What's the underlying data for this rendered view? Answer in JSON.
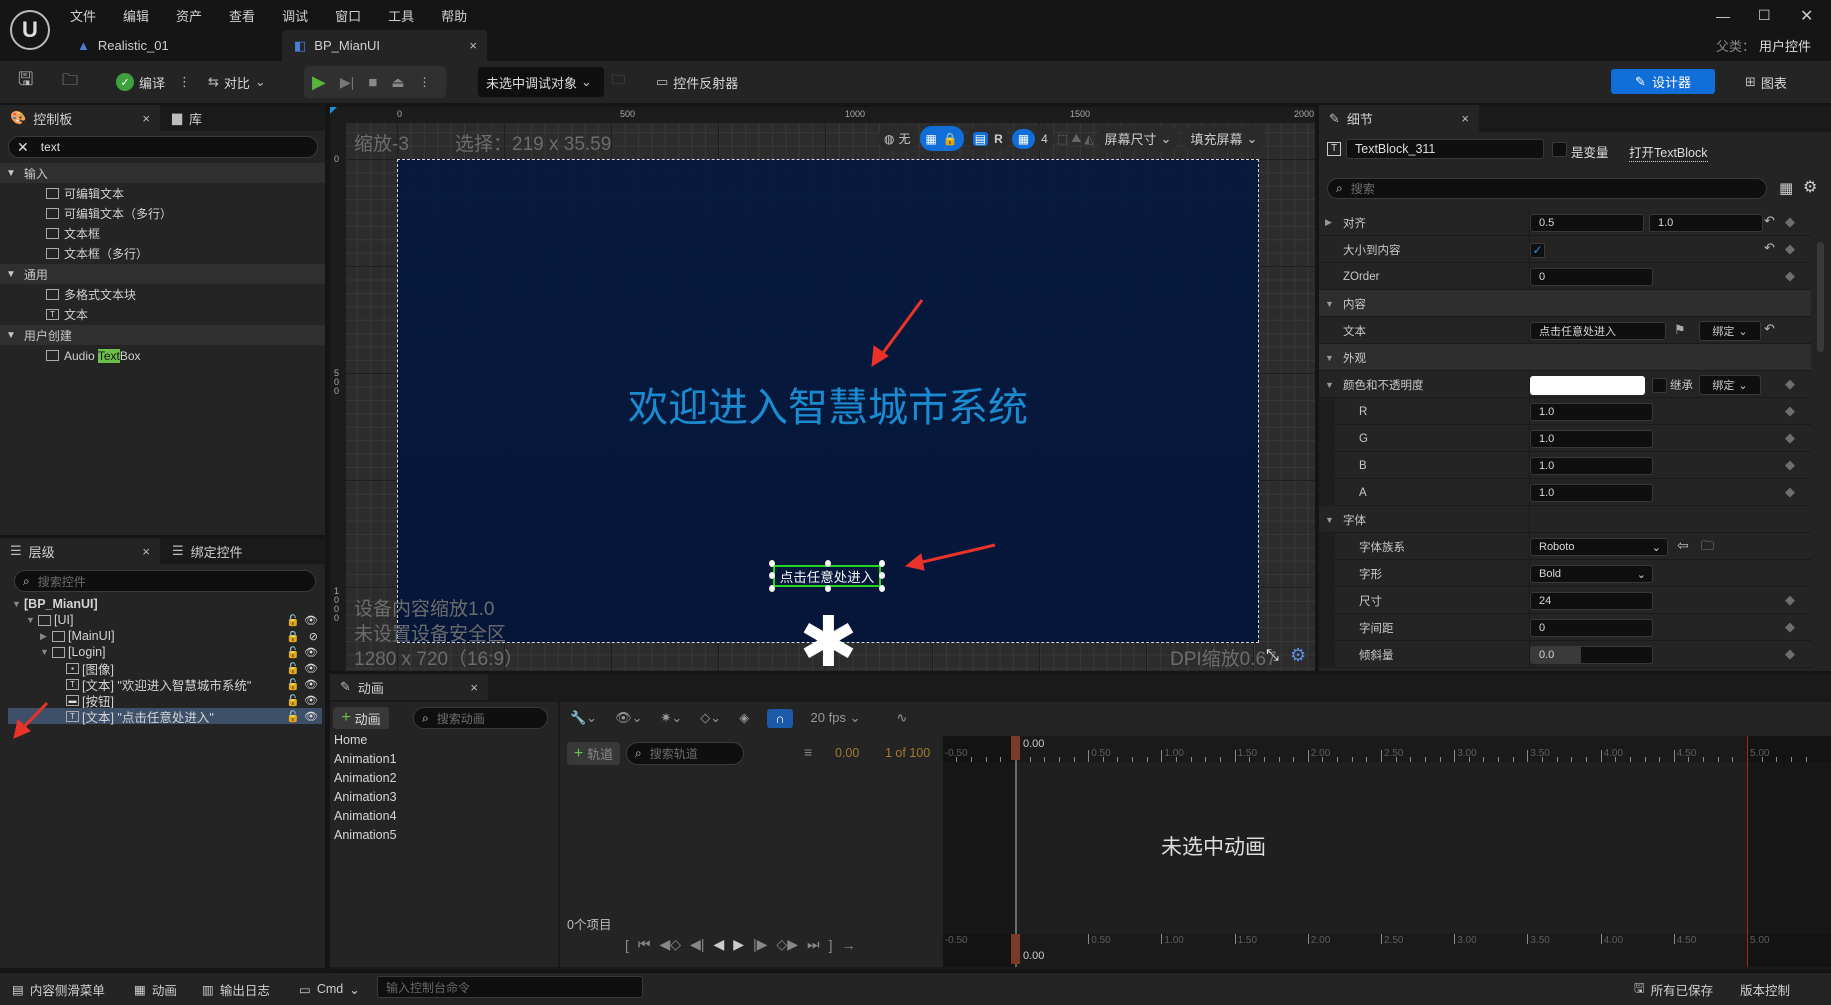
{
  "menu": [
    "文件",
    "编辑",
    "资产",
    "查看",
    "调试",
    "窗口",
    "工具",
    "帮助"
  ],
  "tabs": [
    {
      "label": "Realistic_01",
      "active": false
    },
    {
      "label": "BP_MianUI",
      "active": true
    }
  ],
  "parent_class": {
    "label": "父类：",
    "value": "用户控件"
  },
  "toolbar": {
    "compile": "编译",
    "diff": "对比",
    "debug_target": "未选中调试对象",
    "widget_reflector": "控件反射器",
    "designer": "设计器",
    "graph": "图表"
  },
  "palette": {
    "tab": "控制板",
    "tab2": "库",
    "search_value": "text",
    "categories": [
      {
        "label": "输入",
        "items": [
          {
            "label": "可编辑文本",
            "icon": "editable-text-icon"
          },
          {
            "label": "可编辑文本（多行）",
            "icon": "editable-text-multiline-icon"
          },
          {
            "label": "文本框",
            "icon": "text-box-icon"
          },
          {
            "label": "文本框（多行）",
            "icon": "text-box-multiline-icon"
          }
        ]
      },
      {
        "label": "通用",
        "items": [
          {
            "label": "多格式文本块",
            "icon": "rich-text-icon"
          },
          {
            "label": "文本",
            "icon": "text-icon"
          }
        ]
      },
      {
        "label": "用户创建",
        "items": [
          {
            "label_pre": "Audio ",
            "label_hl": "Text",
            "label_post": "Box",
            "icon": "audio-textbox-icon"
          }
        ]
      }
    ]
  },
  "hierarchy": {
    "tab": "层级",
    "tab2": "绑定控件",
    "search_placeholder": "搜索控件",
    "rows": [
      {
        "label": "[BP_MianUI]",
        "depth": 0,
        "arrow": "down",
        "icon": "",
        "lock": false,
        "eye": false
      },
      {
        "label": "[UI]",
        "depth": 1,
        "arrow": "down",
        "icon": "canvas",
        "lock": "open",
        "eye": "visible"
      },
      {
        "label": "[MainUI]",
        "depth": 2,
        "arrow": "right",
        "icon": "canvas",
        "lock": "locked",
        "eye": "hidden"
      },
      {
        "label": "[Login]",
        "depth": 2,
        "arrow": "down",
        "icon": "canvas",
        "lock": "open",
        "eye": "visible"
      },
      {
        "label": "[图像]",
        "depth": 3,
        "arrow": "",
        "icon": "image",
        "lock": "open",
        "eye": "visible"
      },
      {
        "label": "[文本] \"欢迎进入智慧城市系统\"",
        "depth": 3,
        "arrow": "",
        "icon": "text",
        "lock": "open",
        "eye": "visible"
      },
      {
        "label": "[按钮]",
        "depth": 3,
        "arrow": "",
        "icon": "button",
        "lock": "open",
        "eye": "visible"
      },
      {
        "label": "[文本] \"点击任意处进入\"",
        "depth": 3,
        "arrow": "",
        "icon": "text",
        "lock": "open",
        "eye": "visible",
        "selected": true
      }
    ]
  },
  "canvas": {
    "zoom": "缩放-3",
    "selection": "选择：219 x 35.59",
    "ruler_top": [
      "0",
      "500",
      "1000",
      "1500",
      "2000"
    ],
    "ruler_left": [
      "0",
      "500",
      "1000"
    ],
    "toolbar": {
      "none": "无",
      "r": "R",
      "grid_snap": "4",
      "screen_size": "屏幕尺寸",
      "fill_screen": "填充屏幕"
    },
    "title_text": "欢迎进入智慧城市系统",
    "button_text": "点击任意处进入",
    "title_color": "#1a8fd8",
    "design_bg": "#051a40",
    "selection_color": "#22dd22",
    "device_scale": "设备内容缩放1.0",
    "safe_zone": "未设置设备安全区",
    "resolution": "1280 x 720（16:9）",
    "dpi": "DPI缩放0.67"
  },
  "details": {
    "tab": "细节",
    "name_value": "TextBlock_311",
    "is_variable": "是变量",
    "open_link": "打开TextBlock",
    "search_placeholder": "搜索",
    "rows": [
      {
        "type": "pair",
        "label": "对齐",
        "arrow": "right",
        "values": [
          "0.5",
          "1.0"
        ],
        "reset": true
      },
      {
        "type": "check",
        "label": "大小到内容",
        "checked": true,
        "reset": true
      },
      {
        "type": "value",
        "label": "ZOrder",
        "value": "0"
      },
      {
        "type": "section",
        "label": "内容"
      },
      {
        "type": "text",
        "label": "文本",
        "value": "点击任意处进入",
        "bind": "绑定",
        "reset": true
      },
      {
        "type": "section",
        "label": "外观"
      },
      {
        "type": "color",
        "label": "颜色和不透明度",
        "arrow": "down",
        "swatch": "#ffffff",
        "inherit": "继承",
        "bind": "绑定"
      },
      {
        "type": "value",
        "label": "R",
        "value": "1.0",
        "indent": true
      },
      {
        "type": "value",
        "label": "G",
        "value": "1.0",
        "indent": true
      },
      {
        "type": "value",
        "label": "B",
        "value": "1.0",
        "indent": true
      },
      {
        "type": "value",
        "label": "A",
        "value": "1.0",
        "indent": true
      },
      {
        "type": "section",
        "label": "字体",
        "plain": true
      },
      {
        "type": "dropdown",
        "label": "字体族系",
        "value": "Roboto",
        "indent": true,
        "wide": true
      },
      {
        "type": "dropdown",
        "label": "字形",
        "value": "Bold",
        "indent": true
      },
      {
        "type": "value",
        "label": "尺寸",
        "value": "24",
        "indent": true
      },
      {
        "type": "value",
        "label": "字间距",
        "value": "0",
        "indent": true
      },
      {
        "type": "slider",
        "label": "倾斜量",
        "value": "0.0",
        "indent": true
      }
    ]
  },
  "animation": {
    "tab": "动画",
    "add": "动画",
    "search_placeholder": "搜索动画",
    "list": [
      "Home",
      "Animation1",
      "Animation2",
      "Animation3",
      "Animation4",
      "Animation5"
    ],
    "fps": "20 fps",
    "add_track": "轨道",
    "track_search_placeholder": "搜索轨道",
    "current_time": "0.00",
    "frame": "1 of 100",
    "item_count": "0个项目",
    "empty_message": "未选中动画",
    "ticks": [
      "-0.50",
      "0.00",
      "0.50",
      "1.00",
      "1.50",
      "2.00",
      "2.50",
      "3.00",
      "3.50",
      "4.00",
      "4.50",
      "5.00"
    ],
    "playhead": "0.00"
  },
  "statusbar": {
    "content_drawer": "内容侧滑菜单",
    "animation": "动画",
    "output_log": "输出日志",
    "cmd": "Cmd",
    "console_placeholder": "输入控制台命令",
    "saved": "所有已保存",
    "source_control": "版本控制"
  }
}
